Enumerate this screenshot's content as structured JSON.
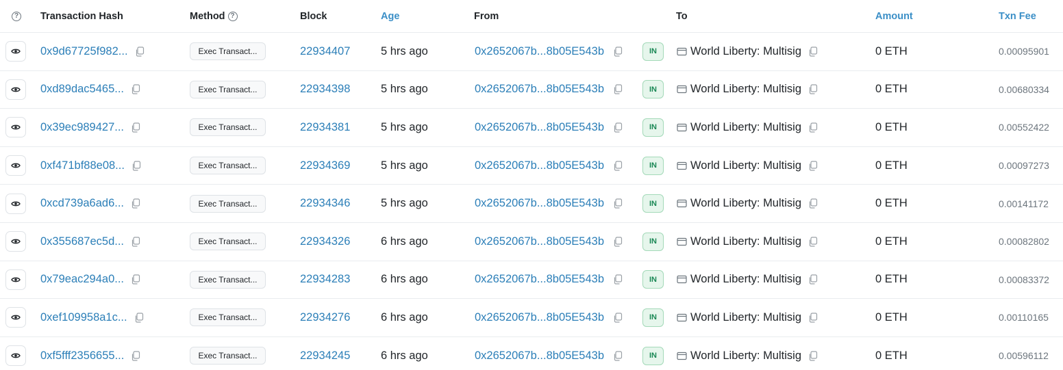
{
  "header": {
    "help_icon": "question-circle-icon",
    "transaction_hash": "Transaction Hash",
    "method": "Method",
    "block": "Block",
    "age": "Age",
    "from": "From",
    "to": "To",
    "amount": "Amount",
    "txn_fee": "Txn Fee"
  },
  "colors": {
    "link": "#2c7fb8",
    "in_badge_bg": "#e6f6ec",
    "in_badge_text": "#198754"
  },
  "rows": [
    {
      "hash": "0x9d67725f982...",
      "method": "Exec Transact...",
      "block": "22934407",
      "age": "5 hrs ago",
      "from": "0x2652067b...8b05E543b",
      "direction": "IN",
      "to": "World Liberty: Multisig",
      "amount": "0 ETH",
      "fee": "0.00095901"
    },
    {
      "hash": "0xd89dac5465...",
      "method": "Exec Transact...",
      "block": "22934398",
      "age": "5 hrs ago",
      "from": "0x2652067b...8b05E543b",
      "direction": "IN",
      "to": "World Liberty: Multisig",
      "amount": "0 ETH",
      "fee": "0.00680334"
    },
    {
      "hash": "0x39ec989427...",
      "method": "Exec Transact...",
      "block": "22934381",
      "age": "5 hrs ago",
      "from": "0x2652067b...8b05E543b",
      "direction": "IN",
      "to": "World Liberty: Multisig",
      "amount": "0 ETH",
      "fee": "0.00552422"
    },
    {
      "hash": "0xf471bf88e08...",
      "method": "Exec Transact...",
      "block": "22934369",
      "age": "5 hrs ago",
      "from": "0x2652067b...8b05E543b",
      "direction": "IN",
      "to": "World Liberty: Multisig",
      "amount": "0 ETH",
      "fee": "0.00097273"
    },
    {
      "hash": "0xcd739a6ad6...",
      "method": "Exec Transact...",
      "block": "22934346",
      "age": "5 hrs ago",
      "from": "0x2652067b...8b05E543b",
      "direction": "IN",
      "to": "World Liberty: Multisig",
      "amount": "0 ETH",
      "fee": "0.00141172"
    },
    {
      "hash": "0x355687ec5d...",
      "method": "Exec Transact...",
      "block": "22934326",
      "age": "6 hrs ago",
      "from": "0x2652067b...8b05E543b",
      "direction": "IN",
      "to": "World Liberty: Multisig",
      "amount": "0 ETH",
      "fee": "0.00082802"
    },
    {
      "hash": "0x79eac294a0...",
      "method": "Exec Transact...",
      "block": "22934283",
      "age": "6 hrs ago",
      "from": "0x2652067b...8b05E543b",
      "direction": "IN",
      "to": "World Liberty: Multisig",
      "amount": "0 ETH",
      "fee": "0.00083372"
    },
    {
      "hash": "0xef109958a1c...",
      "method": "Exec Transact...",
      "block": "22934276",
      "age": "6 hrs ago",
      "from": "0x2652067b...8b05E543b",
      "direction": "IN",
      "to": "World Liberty: Multisig",
      "amount": "0 ETH",
      "fee": "0.00110165"
    },
    {
      "hash": "0xf5fff2356655...",
      "method": "Exec Transact...",
      "block": "22934245",
      "age": "6 hrs ago",
      "from": "0x2652067b...8b05E543b",
      "direction": "IN",
      "to": "World Liberty: Multisig",
      "amount": "0 ETH",
      "fee": "0.00596112"
    }
  ]
}
